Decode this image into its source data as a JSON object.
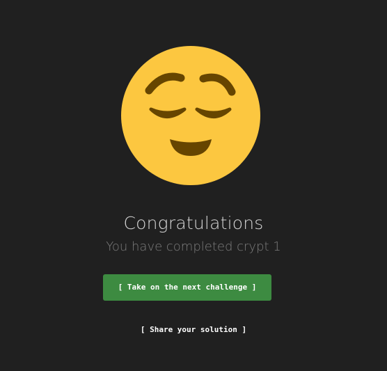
{
  "icon": "relieved-face-icon",
  "colors": {
    "background": "#202020",
    "emoji_face": "#fcc740",
    "emoji_features": "#664500",
    "primary_button": "#3d8b41"
  },
  "result": {
    "title": "Congratulations",
    "subtitle": "You have completed crypt 1"
  },
  "actions": {
    "next_challenge_label": "[ Take on the next challenge ]",
    "share_solution_label": "[ Share your solution ]"
  }
}
